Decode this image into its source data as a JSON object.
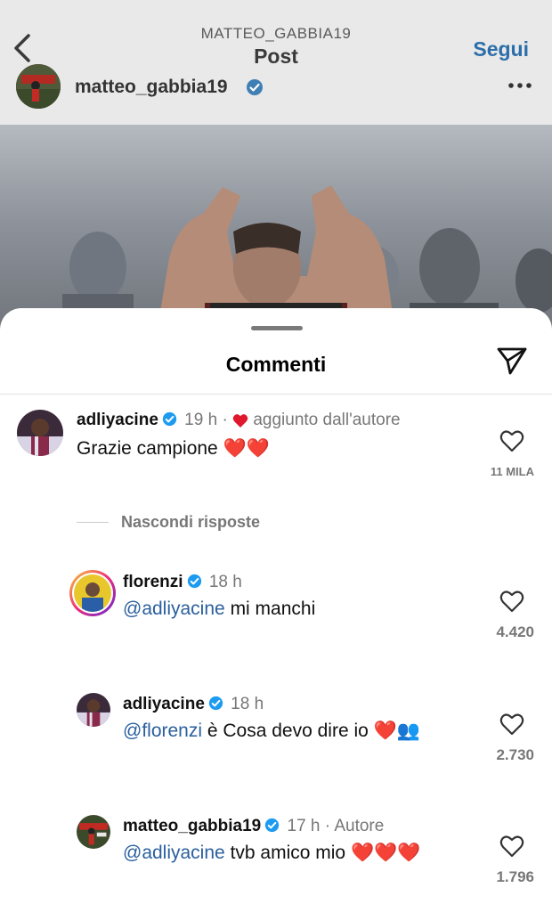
{
  "header": {
    "account_label": "MATTEO_GABBIA19",
    "title": "Post",
    "follow_label": "Segui",
    "back_icon": "chevron-left-icon"
  },
  "post": {
    "username": "matteo_gabbia19",
    "verified": true,
    "more_icon": "ellipsis-icon"
  },
  "sheet": {
    "title": "Commenti",
    "share_icon": "send-icon",
    "hide_replies_label": "Nascondi risposte"
  },
  "comments": [
    {
      "username": "adliyacine",
      "verified": true,
      "time": "19 h",
      "separator": "·",
      "badge": "aggiunto dall'autore",
      "text": "Grazie campione",
      "emoji": "❤️❤️",
      "likes": "11 MILA"
    },
    {
      "username": "florenzi",
      "verified": true,
      "time": "18 h",
      "mention": "@adliyacine",
      "text": "mi manchi",
      "likes": "4.420"
    },
    {
      "username": "adliyacine",
      "verified": true,
      "time": "18 h",
      "mention": "@florenzi",
      "text": "è Cosa devo dire io",
      "emoji": "❤️👥",
      "likes": "2.730"
    },
    {
      "username": "matteo_gabbia19",
      "verified": true,
      "time": "17 h",
      "separator": "·",
      "badge": "Autore",
      "mention": "@adliyacine",
      "text": "tvb amico mio",
      "emoji": "❤️❤️❤️",
      "likes": "1.796"
    }
  ],
  "colors": {
    "accent": "#0095f6",
    "verified": "#1d9bf0",
    "heart": "#e0182d",
    "mention": "#2a5f9e"
  }
}
